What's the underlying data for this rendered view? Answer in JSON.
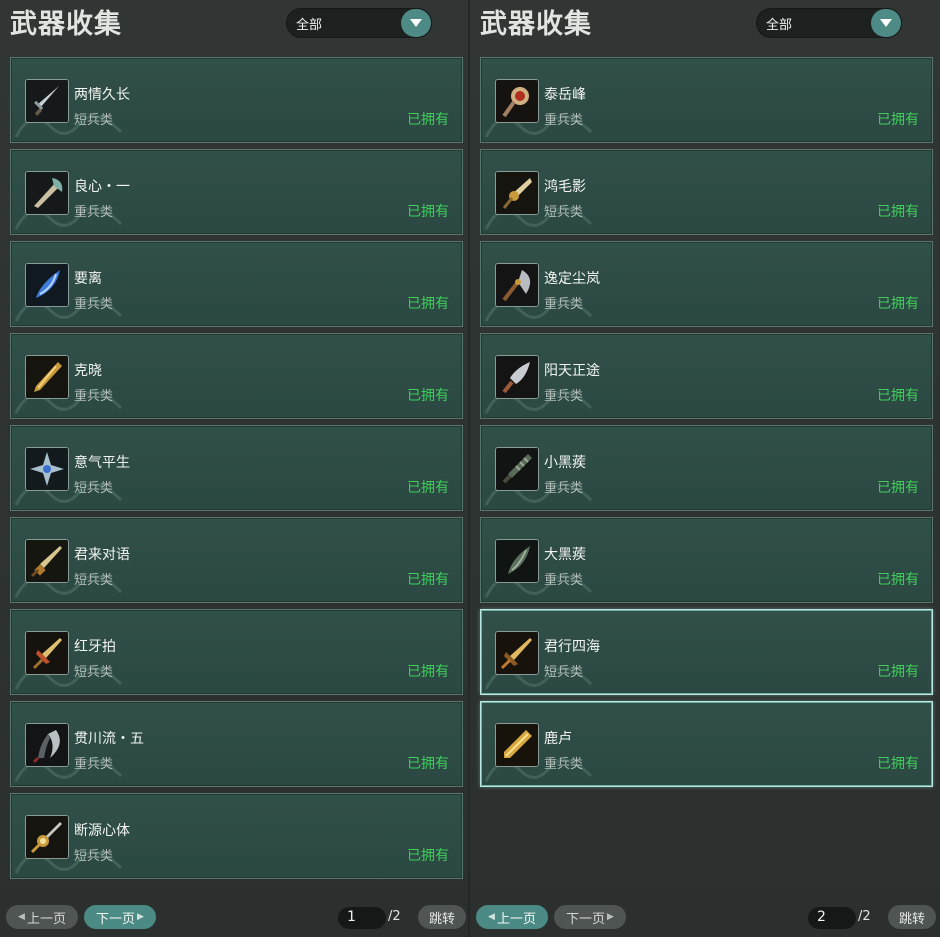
{
  "panels": [
    {
      "title": "武器收集",
      "filter": {
        "label": "全部"
      },
      "items": [
        {
          "name": "两情久长",
          "type": "短兵类",
          "status": "已拥有",
          "icon": "sword-icon"
        },
        {
          "name": "良心・一",
          "type": "重兵类",
          "status": "已拥有",
          "icon": "axe-icon"
        },
        {
          "name": "要离",
          "type": "重兵类",
          "status": "已拥有",
          "icon": "blue-blade-icon"
        },
        {
          "name": "克晓",
          "type": "重兵类",
          "status": "已拥有",
          "icon": "golden-blade-icon"
        },
        {
          "name": "意气平生",
          "type": "短兵类",
          "status": "已拥有",
          "icon": "spiked-star-icon"
        },
        {
          "name": "君来对语",
          "type": "短兵类",
          "status": "已拥有",
          "icon": "dagger-icon"
        },
        {
          "name": "红牙拍",
          "type": "短兵类",
          "status": "已拥有",
          "icon": "ornate-dagger-icon"
        },
        {
          "name": "贯川流・五",
          "type": "重兵类",
          "status": "已拥有",
          "icon": "curved-blade-icon"
        },
        {
          "name": "断源心体",
          "type": "短兵类",
          "status": "已拥有",
          "icon": "ornate-sword-icon"
        }
      ],
      "pager": {
        "prev": "上一页",
        "next": "下一页",
        "page": "1",
        "total": "/2",
        "jump": "跳转"
      }
    },
    {
      "title": "武器收集",
      "filter": {
        "label": "全部"
      },
      "items": [
        {
          "name": "泰岳峰",
          "type": "重兵类",
          "status": "已拥有",
          "icon": "mace-icon"
        },
        {
          "name": "鸿毛影",
          "type": "短兵类",
          "status": "已拥有",
          "icon": "fan-blade-icon"
        },
        {
          "name": "逸定尘岚",
          "type": "重兵类",
          "status": "已拥有",
          "icon": "battle-axe-icon"
        },
        {
          "name": "阳天正途",
          "type": "重兵类",
          "status": "已拥有",
          "icon": "spearhead-icon"
        },
        {
          "name": "小黑蒺",
          "type": "重兵类",
          "status": "已拥有",
          "icon": "dark-club-icon"
        },
        {
          "name": "大黑蒺",
          "type": "重兵类",
          "status": "已拥有",
          "icon": "dark-blade-icon"
        },
        {
          "name": "君行四海",
          "type": "短兵类",
          "status": "已拥有",
          "icon": "gold-dagger-icon"
        },
        {
          "name": "鹿卢",
          "type": "重兵类",
          "status": "已拥有",
          "icon": "gold-sword-icon"
        }
      ],
      "selected": [
        6,
        7
      ],
      "pager": {
        "prev": "上一页",
        "next": "下一页",
        "page": "2",
        "total": "/2",
        "jump": "跳转"
      }
    }
  ],
  "colors": {
    "owned": "#3fce5a",
    "card_bg": "#2e4b45",
    "accent": "#4c8b85"
  }
}
